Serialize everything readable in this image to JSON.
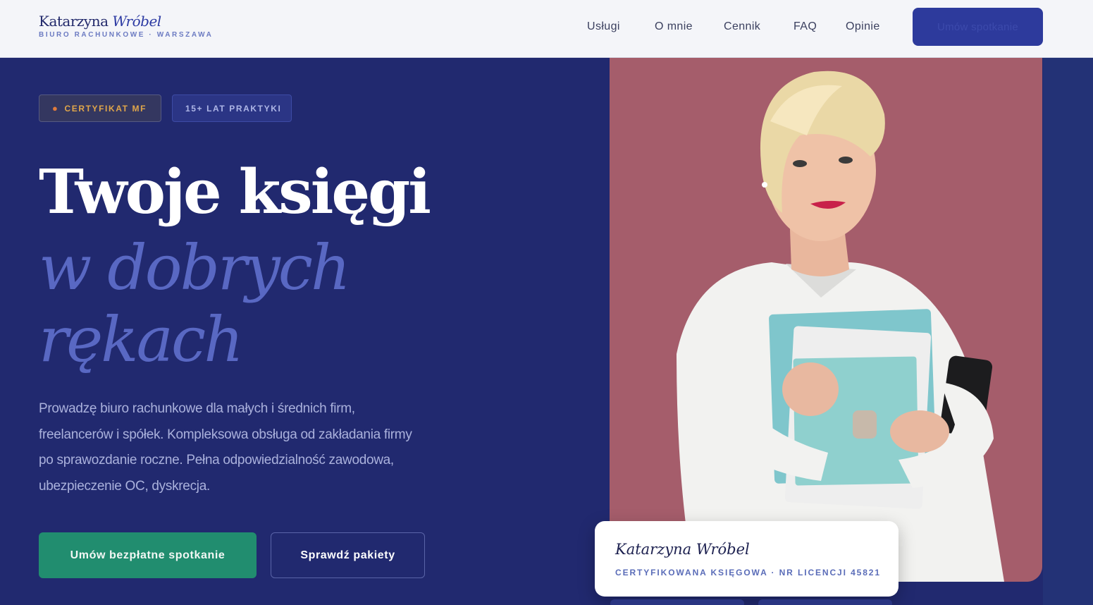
{
  "header": {
    "brand_first": "Katarzyna",
    "brand_last": "Wróbel",
    "brand_sub": "BIURO RACHUNKOWE · WARSZAWA",
    "nav": [
      {
        "label": "Usługi"
      },
      {
        "label": "O mnie"
      },
      {
        "label": "Cennik"
      },
      {
        "label": "FAQ"
      },
      {
        "label": "Opinie"
      }
    ],
    "cta_label": "Umów spotkanie"
  },
  "hero": {
    "badges": {
      "mf": "CERTYFIKAT MF",
      "mf_icon": "medal-icon",
      "lat": "15+ LAT PRAKTYKI"
    },
    "title_line1": "Twoje księgi",
    "title_line2": "w dobrych",
    "title_line3": "rękach",
    "lead": "Prowadzę biuro rachunkowe dla małych i średnich firm, freelancerów i spółek. Kompleksowa obsługa od zakładania firmy po sprawozdanie roczne. Pełna odpowiedzialność zawodowa, ubezpieczenie OC, dyskrecja.",
    "btn_primary": "Umów bezpłatne spotkanie",
    "btn_secondary": "Sprawdź pakiety"
  },
  "profile_card": {
    "name": "Katarzyna Wróbel",
    "subtitle": "CERTYFIKOWANA KSIĘGOWA · NR LICENCJI 45821"
  },
  "colors": {
    "navy_bg": "#21296f",
    "accent_blue": "#5968c3",
    "primary_green": "#218d6f",
    "photo_bg": "#a55d6b",
    "badge_gold": "#e0a64a"
  }
}
